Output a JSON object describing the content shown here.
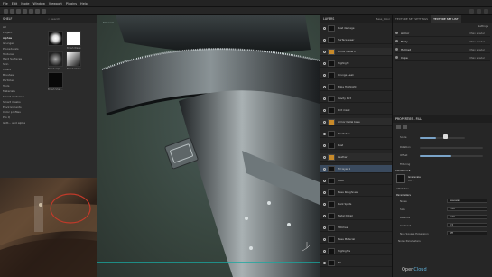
{
  "menubar": {
    "items": [
      "File",
      "Edit",
      "Mode",
      "Window",
      "Viewport",
      "Plugins",
      "Help"
    ]
  },
  "shelf": {
    "title": "SHELF",
    "search_placeholder": "Search",
    "categories": [
      "All",
      "Project",
      "Alphas",
      "Grunges",
      "Procedurals",
      "Textures",
      "Hard Surfaces",
      "Skin",
      "Filters",
      "Brushes",
      "Particles",
      "Tools",
      "Materials",
      "Smart materials",
      "Smart masks",
      "Environments",
      "Color profiles",
      "Pro Q",
      "Glitt... and alpha"
    ],
    "selected_category": "Alphas",
    "thumbs": [
      "Brush Alph...",
      "Brush Wave",
      "Brush Chain",
      "Brush Shar..."
    ]
  },
  "viewport": {
    "mode_label": "Material"
  },
  "layers": {
    "title": "LAYERS",
    "blend": "Base_Color",
    "rows": [
      {
        "name": "Rust damage",
        "folder": false
      },
      {
        "name": "Surface wear",
        "folder": false
      },
      {
        "name": "Armor Metal 2",
        "folder": true
      },
      {
        "name": "Highlight",
        "folder": false
      },
      {
        "name": "Grunge Leak",
        "folder": false
      },
      {
        "name": "Edge Highlight",
        "folder": false
      },
      {
        "name": "Cavity Dirt",
        "folder": false
      },
      {
        "name": "Dirt mask",
        "folder": false
      },
      {
        "name": "Armor Metal base",
        "folder": true
      },
      {
        "name": "Scratches",
        "folder": false
      },
      {
        "name": "Rust",
        "folder": false
      },
      {
        "name": "Leather",
        "folder": true
      },
      {
        "name": "Fill layer 1",
        "folder": false
      },
      {
        "name": "Color",
        "folder": false
      },
      {
        "name": "Base Roughness",
        "folder": false
      },
      {
        "name": "Dark Spots",
        "folder": false
      },
      {
        "name": "Metal Detail",
        "folder": false
      },
      {
        "name": "Stitches",
        "folder": false
      },
      {
        "name": "Base Material",
        "folder": false
      },
      {
        "name": "Highlights",
        "folder": false
      },
      {
        "name": "Fill",
        "folder": false
      }
    ],
    "selected_index": 12
  },
  "texture_set": {
    "tabs": [
      "TEXTURE SET SETTINGS",
      "TEXTURE SET LIST"
    ],
    "active_tab": 1,
    "shader_label": "Settings",
    "channels": [
      {
        "name": "Armor",
        "shader": "Main shader"
      },
      {
        "name": "Body",
        "shader": "Main shader"
      },
      {
        "name": "Helmet",
        "shader": "Main shader"
      },
      {
        "name": "Cape",
        "shader": "Main shader"
      }
    ]
  },
  "properties": {
    "title": "PROPERTIES - FILL",
    "scale_label": "Scale",
    "rotation_label": "Rotation",
    "offset_label": "Offset",
    "filtering_label": "Filtering",
    "section_label": "GRAYSCALE",
    "map_name": "Grayscale",
    "map_sub": "Fill 1",
    "attributes_label": "Attributes",
    "params_label": "Parameters",
    "param_rows": [
      {
        "label": "Noise",
        "value": "Gaussian"
      },
      {
        "label": "Size",
        "value": "1.00"
      },
      {
        "label": "Balance",
        "value": "0.50"
      },
      {
        "label": "Contrast",
        "value": "0.5"
      },
      {
        "label": "Non Square Expansion",
        "value": "Off"
      }
    ],
    "noise_label": "Noise Parameters",
    "scale_fraction": 0.35,
    "rotation_fraction": 0.0,
    "offset_fraction": 0.5
  },
  "watermark": {
    "prefix": "Open",
    "suffix": "Cloud",
    "middle": "Cl"
  },
  "colors": {
    "accent": "#5fb0d8",
    "background": "#1b1b1b",
    "viewport_bg": "#3b4a44"
  }
}
